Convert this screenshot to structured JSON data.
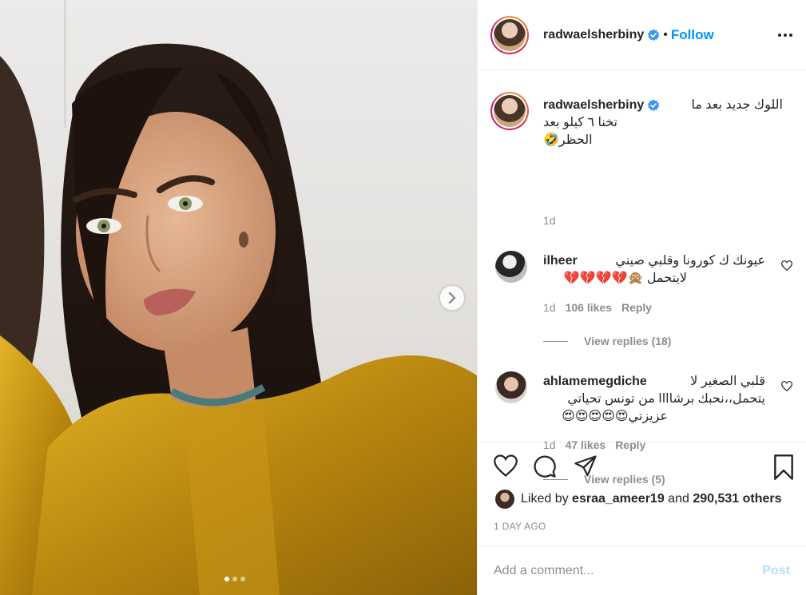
{
  "header": {
    "username": "radwaelsherbiny",
    "separator": "•",
    "follow_label": "Follow"
  },
  "caption": {
    "username": "radwaelsherbiny",
    "text_line1": "اللوك جديد بعد ما",
    "text_line2": "تخنا ٦ كيلو بعد الحظر🤣",
    "time": "1d"
  },
  "comments": [
    {
      "username": "ilheer",
      "text_line1": "عيونك ك كورونا وقلبي صيني",
      "text_line2": "لايتحمل 🙊💔💔💔💔",
      "time": "1d",
      "likes": "106 likes",
      "reply_label": "Reply",
      "view_replies": "View replies (18)"
    },
    {
      "username": "ahlamemegdiche",
      "text_line1": "قلبي الصغير لا",
      "text_line2": "يتحمل،،نحبك برشاااا من تونس تحياتي",
      "text_line3": "عزيزتي😍😍😍😍😍",
      "time": "1d",
      "likes": "47 likes",
      "reply_label": "Reply",
      "view_replies": "View replies (5)"
    }
  ],
  "likes": {
    "prefix": "Liked by",
    "user": "esraa_ameer19",
    "connector": "and",
    "others": "290,531 others"
  },
  "timeago": "1 DAY AGO",
  "add_comment": {
    "placeholder": "Add a comment...",
    "post_label": "Post"
  },
  "colors": {
    "link_blue": "#0095f6",
    "post_disabled": "#b2dffc",
    "muted": "#8e8e8e",
    "verified": "#3897f0"
  }
}
